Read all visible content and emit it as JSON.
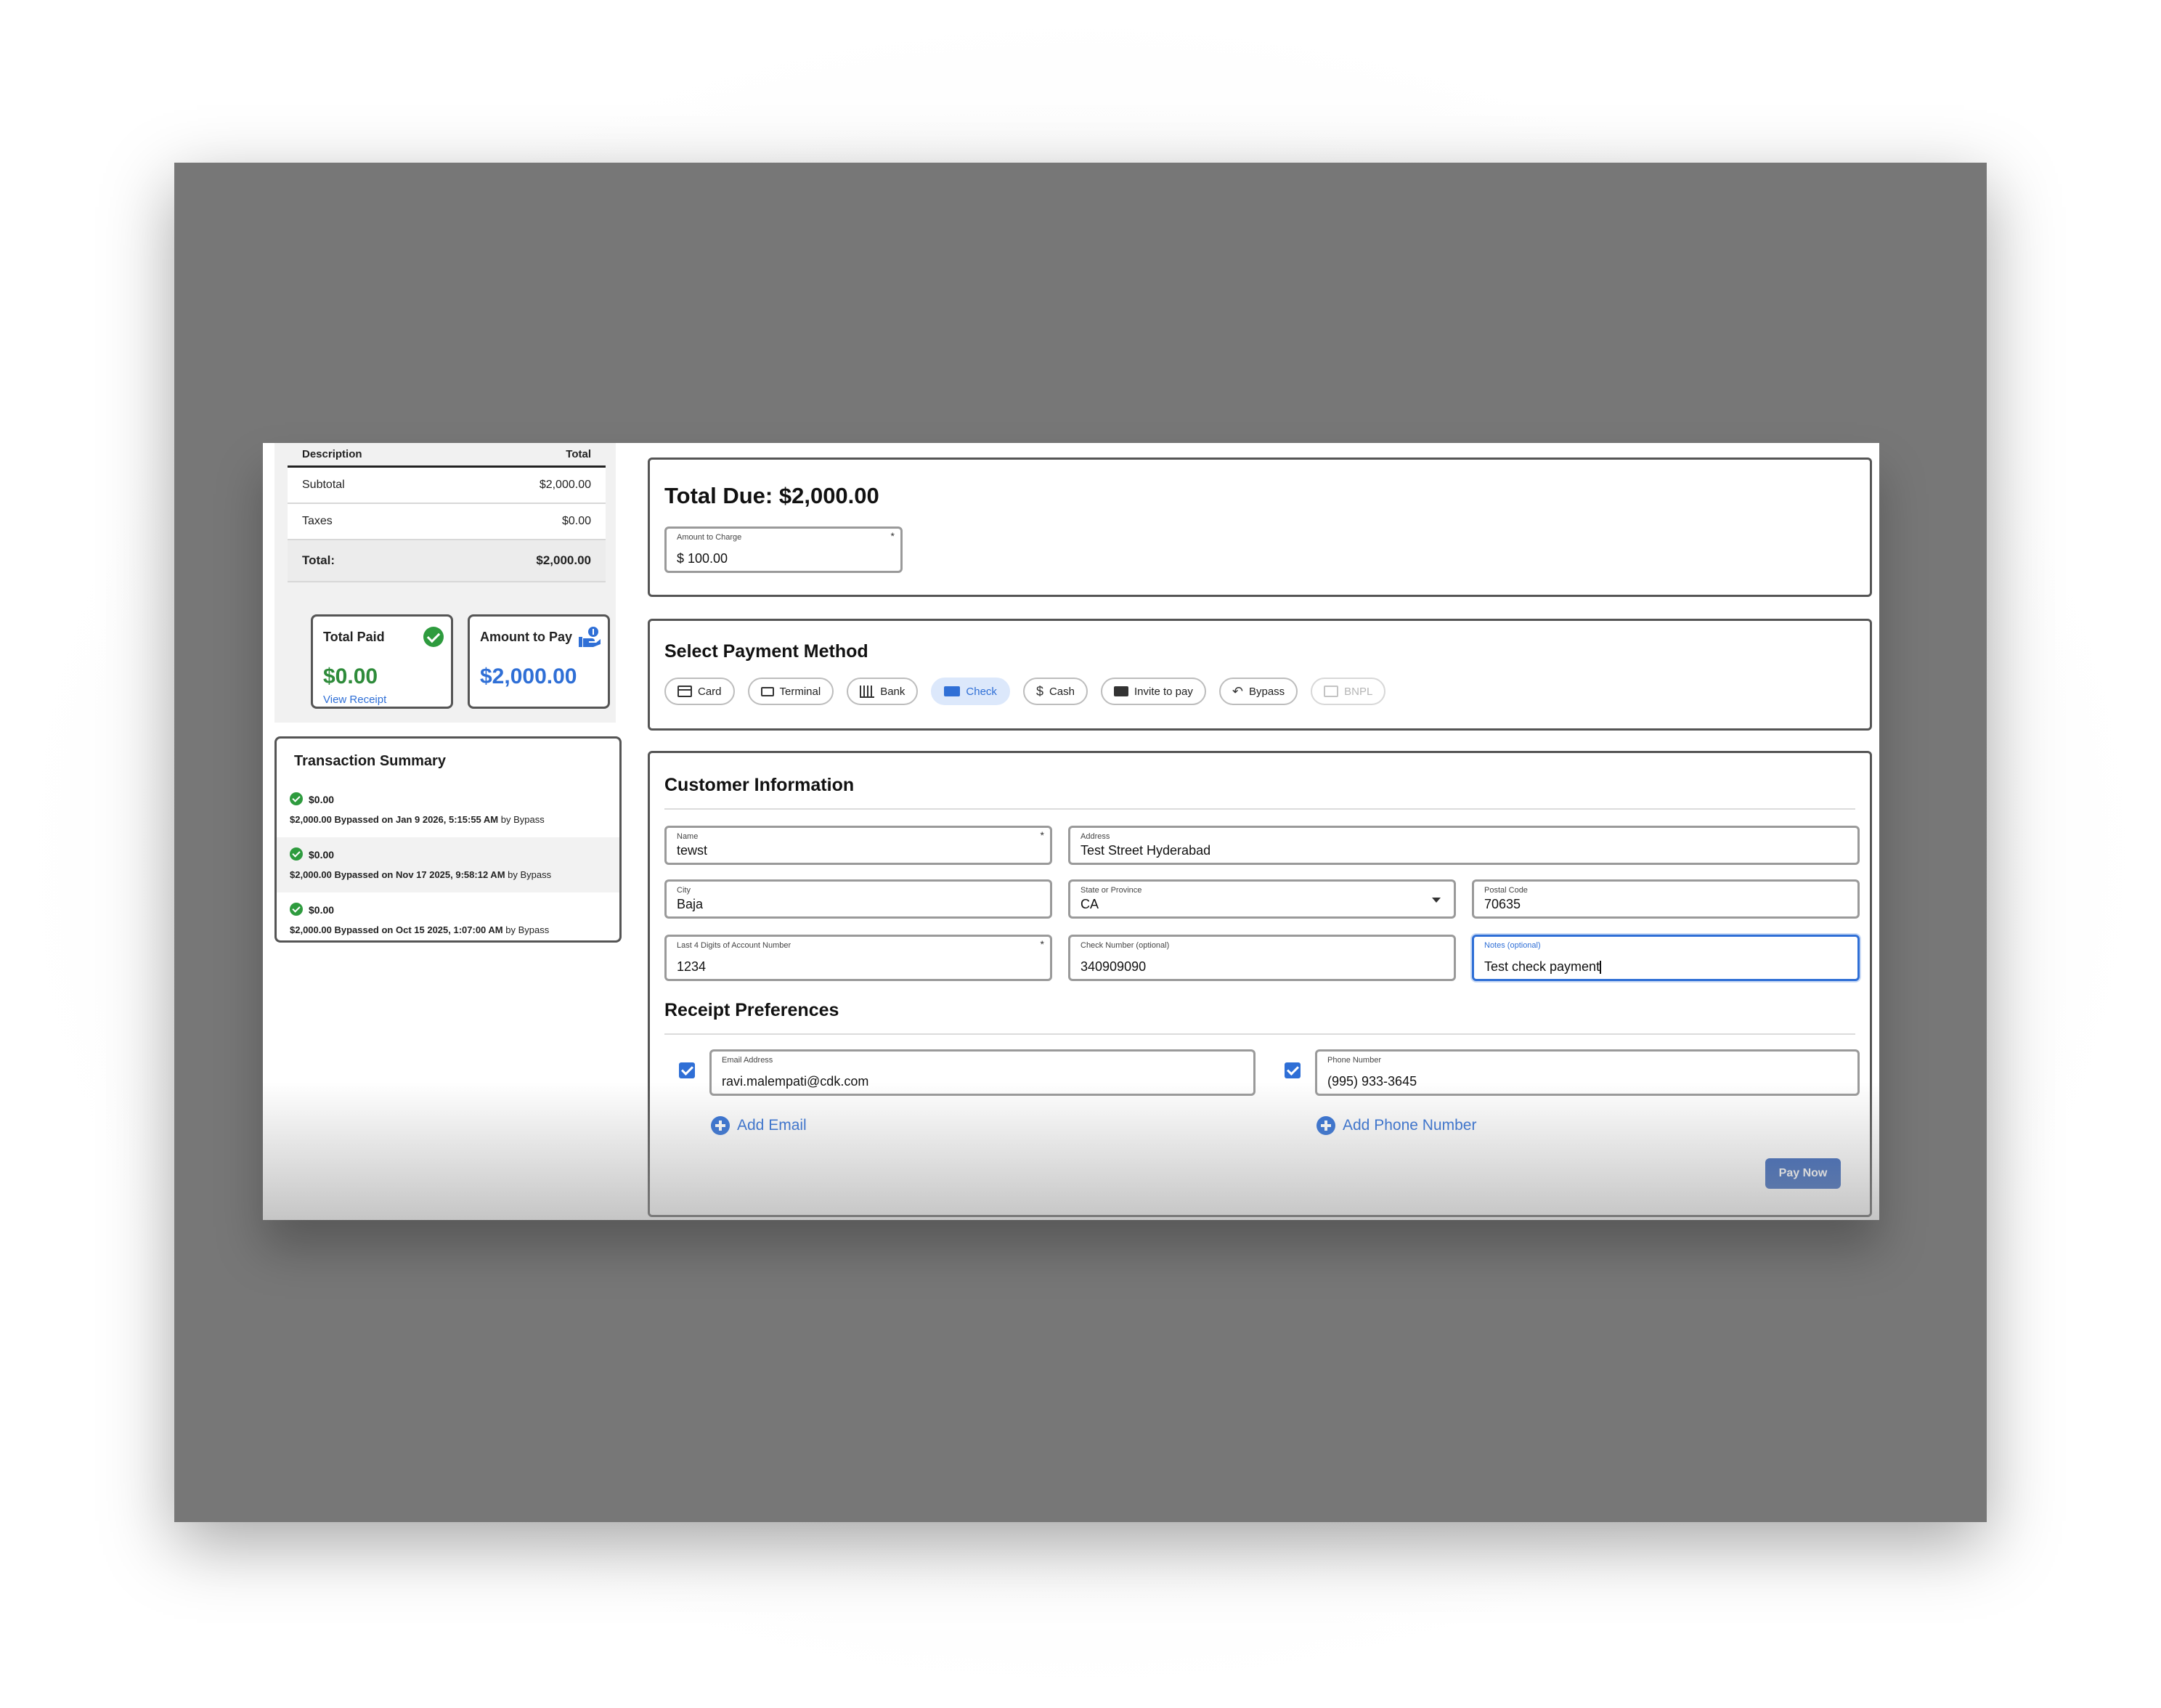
{
  "invoice": {
    "headers": {
      "description": "Description",
      "total": "Total"
    },
    "rows": [
      {
        "label": "Subtotal",
        "value": "$2,000.00"
      },
      {
        "label": "Taxes",
        "value": "$0.00"
      }
    ],
    "total": {
      "label": "Total:",
      "value": "$2,000.00"
    }
  },
  "summary_cards": {
    "paid": {
      "title": "Total Paid",
      "amount": "$0.00",
      "link": "View Receipt"
    },
    "to_pay": {
      "title": "Amount to Pay",
      "amount": "$2,000.00"
    }
  },
  "transactions": {
    "title": "Transaction Summary",
    "items": [
      {
        "amount": "$0.00",
        "prefix": "$2,000.00 Bypassed on",
        "date": "Jan 9 2026, 5:15:55 AM",
        "suffix": "by Bypass"
      },
      {
        "amount": "$0.00",
        "prefix": "$2,000.00 Bypassed on",
        "date": "Nov 17 2025, 9:58:12 AM",
        "suffix": "by Bypass"
      },
      {
        "amount": "$0.00",
        "prefix": "$2,000.00 Bypassed on",
        "date": "Oct 15 2025, 1:07:00 AM",
        "suffix": "by Bypass"
      }
    ]
  },
  "total_due": {
    "title": "Total Due: $2,000.00",
    "amount_field": {
      "label": "Amount to Charge",
      "value": "$ 100.00",
      "required": "*"
    }
  },
  "payment_method": {
    "title": "Select Payment Method",
    "selected": "Check",
    "options": [
      {
        "label": "Card",
        "icon": "card-icon"
      },
      {
        "label": "Terminal",
        "icon": "terminal-icon"
      },
      {
        "label": "Bank",
        "icon": "bank-icon"
      },
      {
        "label": "Check",
        "icon": "check-icon"
      },
      {
        "label": "Cash",
        "icon": "dollar-icon"
      },
      {
        "label": "Invite to pay",
        "icon": "mail-icon"
      },
      {
        "label": "Bypass",
        "icon": "undo-icon"
      },
      {
        "label": "BNPL",
        "icon": "bnpl-icon"
      }
    ]
  },
  "customer": {
    "title": "Customer Information",
    "name": {
      "label": "Name",
      "value": "tewst",
      "required": "*"
    },
    "address": {
      "label": "Address",
      "value": "Test Street Hyderabad"
    },
    "city": {
      "label": "City",
      "value": "Baja"
    },
    "state": {
      "label": "State or Province",
      "value": "CA"
    },
    "postal": {
      "label": "Postal Code",
      "value": "70635"
    },
    "account": {
      "label": "Last 4 Digits of Account Number",
      "value": "1234",
      "required": "*"
    },
    "check_number": {
      "label": "Check Number (optional)",
      "value": "340909090"
    },
    "notes": {
      "label": "Notes (optional)",
      "value": "Test check payment"
    }
  },
  "receipt": {
    "title": "Receipt Preferences",
    "email": {
      "label": "Email Address",
      "value": "ravi.malempati@cdk.com",
      "checked": true
    },
    "phone": {
      "label": "Phone Number",
      "value": "(995) 933-3645",
      "checked": true
    },
    "add_email": "Add Email",
    "add_phone": "Add Phone Number",
    "pay_button": "Pay Now"
  },
  "colors": {
    "accent": "#2f6fd6",
    "success": "#2e9b3e",
    "button": "#2f5fb8",
    "backdrop": "#777777"
  }
}
